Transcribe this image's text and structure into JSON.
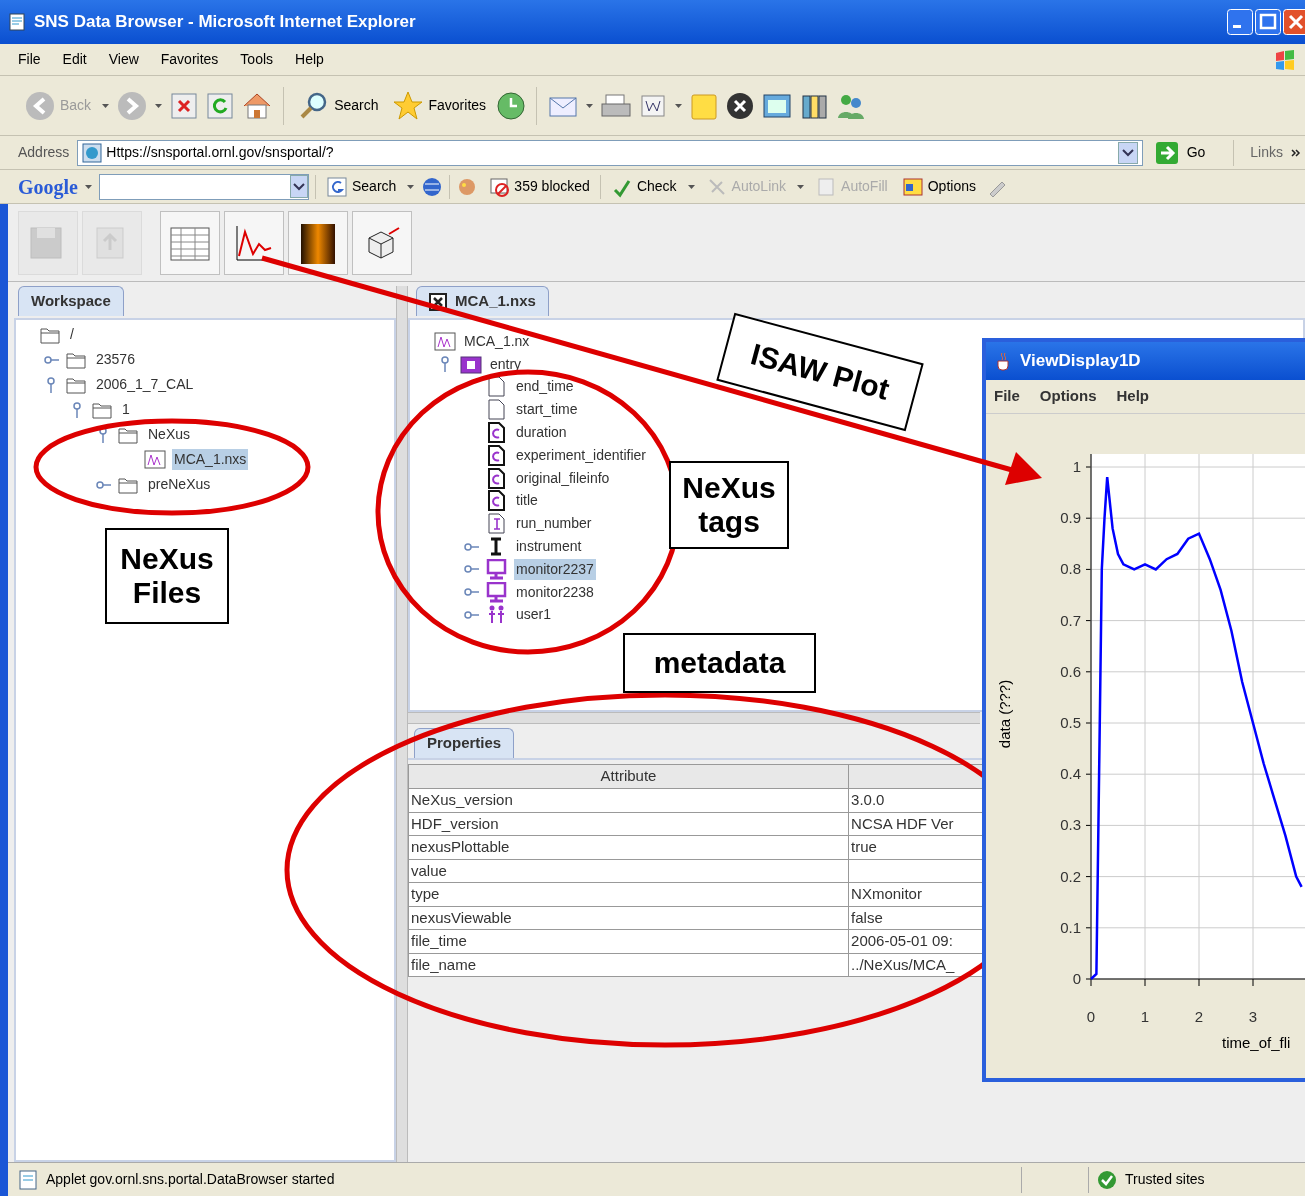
{
  "window": {
    "title": "SNS Data Browser - Microsoft Internet Explorer"
  },
  "menu": [
    "File",
    "Edit",
    "View",
    "Favorites",
    "Tools",
    "Help"
  ],
  "toolbar": [
    {
      "kind": "back",
      "label": "Back",
      "disabled": true
    },
    {
      "kind": "search",
      "label": "Search",
      "disabled": false
    },
    {
      "kind": "favorites",
      "label": "Favorites",
      "disabled": false
    }
  ],
  "address_bar": {
    "label": "Address",
    "url": "Https://snsportal.ornl.gov/snsportal/?",
    "go": "Go",
    "links": "Links"
  },
  "google_bar": {
    "logo": "Google",
    "items": [
      {
        "kind": "search",
        "label": "Search",
        "disabled": false
      },
      {
        "kind": "blocker",
        "label": "359 blocked",
        "disabled": false
      },
      {
        "kind": "spell",
        "label": "Check",
        "disabled": false
      },
      {
        "kind": "autolink",
        "label": "AutoLink",
        "disabled": true
      },
      {
        "kind": "autofill",
        "label": "AutoFill",
        "disabled": true
      },
      {
        "kind": "options",
        "label": "Options",
        "disabled": false
      }
    ]
  },
  "app_toolbar": [
    {
      "kind": "save",
      "disabled": true
    },
    {
      "kind": "export",
      "disabled": true
    },
    {
      "kind": "table",
      "disabled": false
    },
    {
      "kind": "plot",
      "disabled": false
    },
    {
      "kind": "image",
      "disabled": false
    },
    {
      "kind": "cube",
      "disabled": false
    }
  ],
  "workspace": {
    "tab": "Workspace",
    "tree": [
      {
        "label": "/",
        "kind": "folder",
        "selected": false,
        "children": [
          {
            "label": "23576",
            "kind": "folder",
            "expanded": false,
            "selected": false
          },
          {
            "label": "2006_1_7_CAL",
            "kind": "folder",
            "expanded": true,
            "selected": false,
            "children": [
              {
                "label": "1",
                "kind": "folder",
                "expanded": true,
                "selected": false,
                "children": [
                  {
                    "label": "NeXus",
                    "kind": "folder",
                    "expanded": true,
                    "selected": false,
                    "children": [
                      {
                        "label": "MCA_1.nxs",
                        "kind": "nexus",
                        "selected": true
                      }
                    ]
                  },
                  {
                    "label": "preNeXus",
                    "kind": "folder",
                    "expanded": false,
                    "selected": false
                  }
                ]
              }
            ]
          }
        ]
      }
    ]
  },
  "file_view": {
    "tab": "MCA_1.nxs",
    "tree": [
      {
        "label": "MCA_1.nx",
        "kind": "nexus",
        "selected": false,
        "children": [
          {
            "label": "entry",
            "kind": "group",
            "expanded": true,
            "selected": false,
            "children": [
              {
                "label": "end_time",
                "kind": "text",
                "selected": false
              },
              {
                "label": "start_time",
                "kind": "text",
                "selected": false
              },
              {
                "label": "duration",
                "kind": "char",
                "selected": false
              },
              {
                "label": "experiment_identifier",
                "kind": "char",
                "selected": false
              },
              {
                "label": "original_fileinfo",
                "kind": "char",
                "selected": false
              },
              {
                "label": "title",
                "kind": "char",
                "selected": false
              },
              {
                "label": "run_number",
                "kind": "int",
                "selected": false
              },
              {
                "label": "instrument",
                "kind": "instrument",
                "expanded": false,
                "selected": false
              },
              {
                "label": "monitor2237",
                "kind": "monitor",
                "expanded": false,
                "selected": true
              },
              {
                "label": "monitor2238",
                "kind": "monitor",
                "expanded": false,
                "selected": false
              },
              {
                "label": "user1",
                "kind": "user",
                "expanded": false,
                "selected": false
              }
            ]
          }
        ]
      }
    ]
  },
  "properties": {
    "tab": "Properties",
    "columns": [
      "Attribute"
    ],
    "rows": [
      [
        "NeXus_version",
        "3.0.0"
      ],
      [
        "HDF_version",
        "NCSA HDF Ver"
      ],
      [
        "nexusPlottable",
        "true"
      ],
      [
        "value",
        ""
      ],
      [
        "type",
        "NXmonitor"
      ],
      [
        "nexusViewable",
        "false"
      ],
      [
        "file_time",
        "2006-05-01 09:"
      ],
      [
        "file_name",
        "../NeXus/MCA_"
      ]
    ]
  },
  "plot_window": {
    "title": "ViewDisplay1D",
    "menu": [
      "File",
      "Options",
      "Help"
    ],
    "chart_data": {
      "type": "line",
      "xlabel": "time_of_fli",
      "ylabel": "data (???)",
      "xlim": [
        0,
        4
      ],
      "ylim": [
        0,
        1
      ],
      "grid": true,
      "xticks": [
        0,
        1,
        2,
        3
      ],
      "yticks": [
        0,
        0.1,
        0.2,
        0.3,
        0.4,
        0.5,
        0.6,
        0.7,
        0.8,
        0.9,
        1
      ],
      "x": [
        0,
        0.1,
        0.15,
        0.2,
        0.25,
        0.3,
        0.4,
        0.5,
        0.6,
        0.8,
        1.0,
        1.2,
        1.4,
        1.6,
        1.8,
        2.0,
        2.2,
        2.4,
        2.6,
        2.8,
        3.0,
        3.2,
        3.4,
        3.6,
        3.8,
        3.9
      ],
      "series": [
        {
          "color": "#0000ff",
          "values": [
            0,
            0.01,
            0.4,
            0.8,
            0.9,
            0.98,
            0.88,
            0.83,
            0.81,
            0.8,
            0.81,
            0.8,
            0.82,
            0.83,
            0.86,
            0.87,
            0.82,
            0.76,
            0.68,
            0.58,
            0.5,
            0.42,
            0.35,
            0.28,
            0.2,
            0.18
          ]
        }
      ]
    }
  },
  "annotations": [
    "NeXus Files",
    "NeXus tags",
    "ISAW Plot",
    "metadata"
  ],
  "status_bar": {
    "text": "Applet gov.ornl.sns.portal.DataBrowser started",
    "zone": "Trusted sites"
  }
}
